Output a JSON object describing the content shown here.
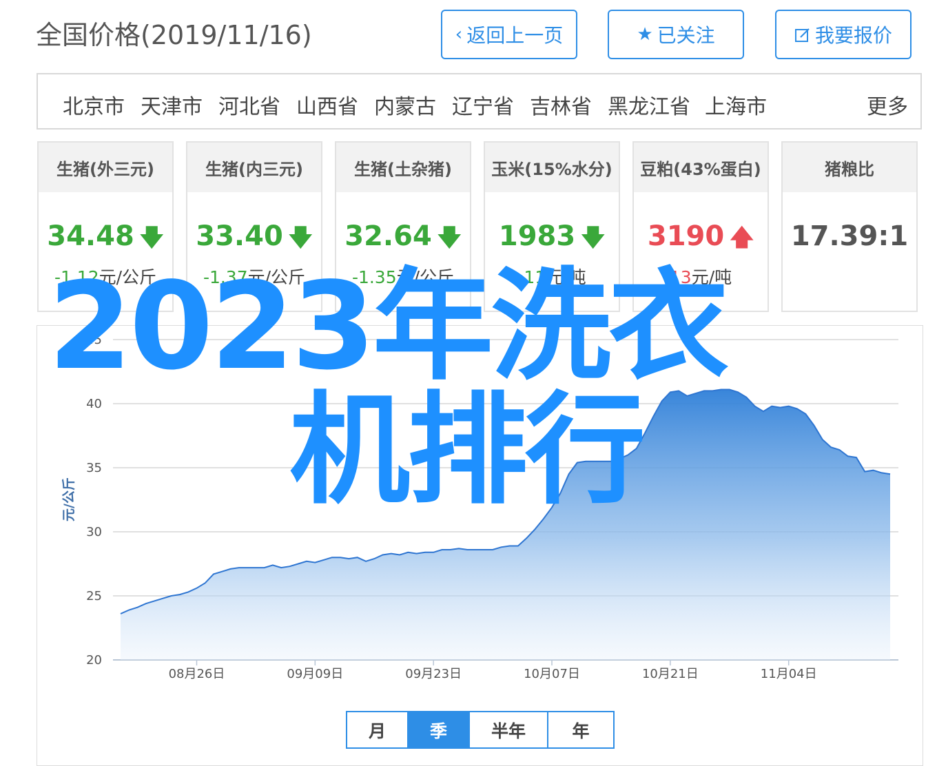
{
  "header": {
    "title": "全国价格(2019/11/16)",
    "back_label": "返回上一页",
    "follow_label": "已关注",
    "quote_label": "我要报价"
  },
  "regions": {
    "items": [
      "北京市",
      "天津市",
      "河北省",
      "山西省",
      "内蒙古",
      "辽宁省",
      "吉林省",
      "黑龙江省",
      "上海市"
    ],
    "more_label": "更多"
  },
  "cards": [
    {
      "name": "生猪(外三元)",
      "value": "34.48",
      "change_num": "-1.12",
      "change_unit": "元/公斤",
      "trend": "down"
    },
    {
      "name": "生猪(内三元)",
      "value": "33.40",
      "change_num": "-1.37",
      "change_unit": "元/公斤",
      "trend": "down"
    },
    {
      "name": "生猪(土杂猪)",
      "value": "32.64",
      "change_num": "-1.35",
      "change_unit": "元/公斤",
      "trend": "down"
    },
    {
      "name": "玉米(15%水分)",
      "value": "1983",
      "change_num": "-11",
      "change_unit": "元/吨",
      "trend": "down"
    },
    {
      "name": "豆粕(43%蛋白)",
      "value": "3190",
      "change_num": "13",
      "change_unit": "元/吨",
      "trend": "up"
    },
    {
      "name": "猪粮比",
      "value": "17.39:1",
      "change_num": "",
      "change_unit": "",
      "trend": "none"
    }
  ],
  "colors": {
    "accent": "#2e8ee6",
    "down": "#3aa83a",
    "up": "#e94c55",
    "overlay": "#1e90ff"
  },
  "icons": {
    "back": "chevron-left-icon",
    "follow": "star-icon",
    "quote": "edit-icon",
    "down": "arrow-down-icon",
    "up": "arrow-up-icon"
  },
  "chart_data": {
    "type": "area",
    "ylabel": "元/公斤",
    "ylim": [
      20,
      45
    ],
    "yticks": [
      20,
      25,
      30,
      35,
      40,
      45
    ],
    "grid": true,
    "xlabels": [
      "08月26日",
      "09月09日",
      "09月23日",
      "10月07日",
      "10月21日",
      "11月04日"
    ],
    "x": [
      "2019-08-17",
      "2019-08-18",
      "2019-08-19",
      "2019-08-20",
      "2019-08-21",
      "2019-08-22",
      "2019-08-23",
      "2019-08-24",
      "2019-08-25",
      "2019-08-26",
      "2019-08-27",
      "2019-08-28",
      "2019-08-29",
      "2019-08-30",
      "2019-08-31",
      "2019-09-01",
      "2019-09-02",
      "2019-09-03",
      "2019-09-04",
      "2019-09-05",
      "2019-09-06",
      "2019-09-07",
      "2019-09-08",
      "2019-09-09",
      "2019-09-10",
      "2019-09-11",
      "2019-09-12",
      "2019-09-13",
      "2019-09-14",
      "2019-09-15",
      "2019-09-16",
      "2019-09-17",
      "2019-09-18",
      "2019-09-19",
      "2019-09-20",
      "2019-09-21",
      "2019-09-22",
      "2019-09-23",
      "2019-09-24",
      "2019-09-25",
      "2019-09-26",
      "2019-09-27",
      "2019-09-28",
      "2019-09-29",
      "2019-09-30",
      "2019-10-01",
      "2019-10-02",
      "2019-10-03",
      "2019-10-04",
      "2019-10-05",
      "2019-10-06",
      "2019-10-07",
      "2019-10-08",
      "2019-10-09",
      "2019-10-10",
      "2019-10-11",
      "2019-10-12",
      "2019-10-13",
      "2019-10-14",
      "2019-10-15",
      "2019-10-16",
      "2019-10-17",
      "2019-10-18",
      "2019-10-19",
      "2019-10-20",
      "2019-10-21",
      "2019-10-22",
      "2019-10-23",
      "2019-10-24",
      "2019-10-25",
      "2019-10-26",
      "2019-10-27",
      "2019-10-28",
      "2019-10-29",
      "2019-10-30",
      "2019-10-31",
      "2019-11-01",
      "2019-11-02",
      "2019-11-03",
      "2019-11-04",
      "2019-11-05",
      "2019-11-06",
      "2019-11-07",
      "2019-11-08",
      "2019-11-09",
      "2019-11-10",
      "2019-11-11",
      "2019-11-12",
      "2019-11-13",
      "2019-11-14",
      "2019-11-15",
      "2019-11-16"
    ],
    "series": [
      {
        "values": [
          23.6,
          23.9,
          24.1,
          24.4,
          24.6,
          24.8,
          25.0,
          25.1,
          25.3,
          25.6,
          26.0,
          26.7,
          26.9,
          27.1,
          27.2,
          27.2,
          27.2,
          27.2,
          27.4,
          27.2,
          27.3,
          27.5,
          27.7,
          27.6,
          27.8,
          28.0,
          28.0,
          27.9,
          28.0,
          27.7,
          27.9,
          28.2,
          28.3,
          28.2,
          28.4,
          28.3,
          28.4,
          28.4,
          28.6,
          28.6,
          28.7,
          28.6,
          28.6,
          28.6,
          28.6,
          28.8,
          28.9,
          28.9,
          29.5,
          30.2,
          31.0,
          31.9,
          33.0,
          34.5,
          35.4,
          35.5,
          35.5,
          35.5,
          35.5,
          35.7,
          36.0,
          36.5,
          37.7,
          39.0,
          40.2,
          40.9,
          41.0,
          40.6,
          40.8,
          41.0,
          41.0,
          41.1,
          41.1,
          40.9,
          40.5,
          39.8,
          39.4,
          39.8,
          39.7,
          39.8,
          39.6,
          39.2,
          38.3,
          37.2,
          36.6,
          36.4,
          35.9,
          35.8,
          34.7,
          34.8,
          34.6,
          34.5
        ]
      }
    ]
  },
  "range_tabs": {
    "items": [
      "月",
      "季",
      "半年",
      "年"
    ],
    "active": "季"
  },
  "overlay_text": {
    "line1": "2023年洗衣",
    "line2": "机排行"
  }
}
